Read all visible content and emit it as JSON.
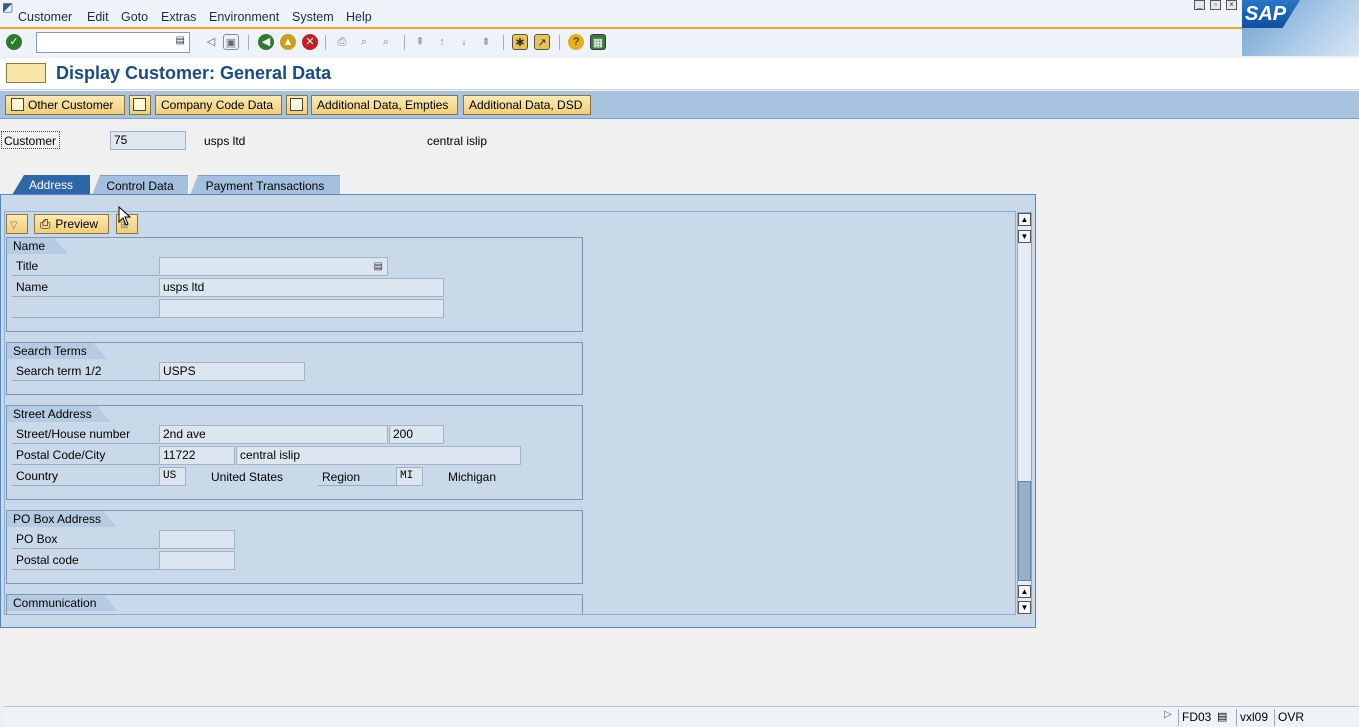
{
  "menu": [
    "Customer",
    "Edit",
    "Goto",
    "Extras",
    "Environment",
    "System",
    "Help"
  ],
  "title": "Display Customer: General Data",
  "app_buttons": {
    "other_customer": "Other Customer",
    "company_code": "Company Code Data",
    "additional_empties": "Additional Data, Empties",
    "additional_dsd": "Additional Data, DSD"
  },
  "customer": {
    "label": "Customer",
    "number": "75",
    "name": "usps ltd",
    "city": "central islip"
  },
  "tabs": [
    "Address",
    "Control Data",
    "Payment Transactions"
  ],
  "preview_label": "Preview",
  "name_group": {
    "heading": "Name",
    "title_label": "Title",
    "title_value": "",
    "name_label": "Name",
    "name_value": "usps ltd",
    "name2_value": ""
  },
  "search_group": {
    "heading": "Search Terms",
    "label": "Search term 1/2",
    "value": "USPS"
  },
  "street_group": {
    "heading": "Street Address",
    "street_label": "Street/House number",
    "street": "2nd ave",
    "house": "200",
    "postal_label": "Postal Code/City",
    "postal": "11722",
    "city": "central islip",
    "country_label": "Country",
    "country_code": "US",
    "country_name": "United States",
    "region_label": "Region",
    "region_code": "MI",
    "region_name": "Michigan"
  },
  "pobox_group": {
    "heading": "PO Box Address",
    "pobox_label": "PO Box",
    "postal_label": "Postal code"
  },
  "comm_group": {
    "heading": "Communication"
  },
  "status": {
    "tcode": "FD03",
    "server": "vxl09",
    "mode": "OVR"
  }
}
